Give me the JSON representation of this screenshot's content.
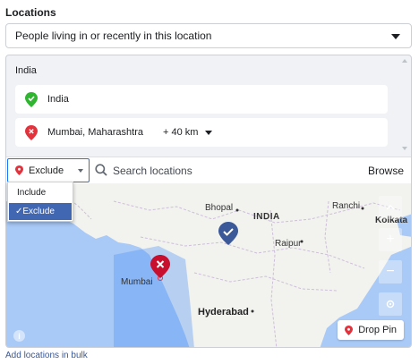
{
  "section_label": "Locations",
  "audience_select": {
    "value": "People living in or recently in this location"
  },
  "panel": {
    "region_header": "India",
    "locations": [
      {
        "name": "India",
        "status": "included"
      },
      {
        "name": "Mumbai, Maharashtra",
        "radius": "+ 40 km",
        "status": "excluded"
      }
    ]
  },
  "search_row": {
    "mode_value": "Exclude",
    "search_placeholder": "Search locations",
    "browse_label": "Browse"
  },
  "mode_menu": {
    "options": [
      "Include",
      "Exclude"
    ],
    "selected": "Exclude",
    "selected_display": "✓Exclude"
  },
  "map": {
    "labels": {
      "bhopal": "Bhopal",
      "india": "INDIA",
      "ranchi": "Ranchi",
      "kolkata": "Kolkata",
      "raipur": "Raipur",
      "mumbai": "Mumbai",
      "hyderabad": "Hyderabad"
    },
    "controls": [
      "chevron-up",
      "plus",
      "minus",
      "locate"
    ],
    "drop_pin_label": "Drop Pin"
  },
  "add_bulk_link": "Add locations in bulk",
  "colors": {
    "include_green": "#2fb52f",
    "exclude_red": "#e4323d",
    "accent_blue": "#1877f2",
    "map_water": "#a9c9f6",
    "map_land": "#f2f2ef",
    "menu_selected": "#4267b2"
  }
}
